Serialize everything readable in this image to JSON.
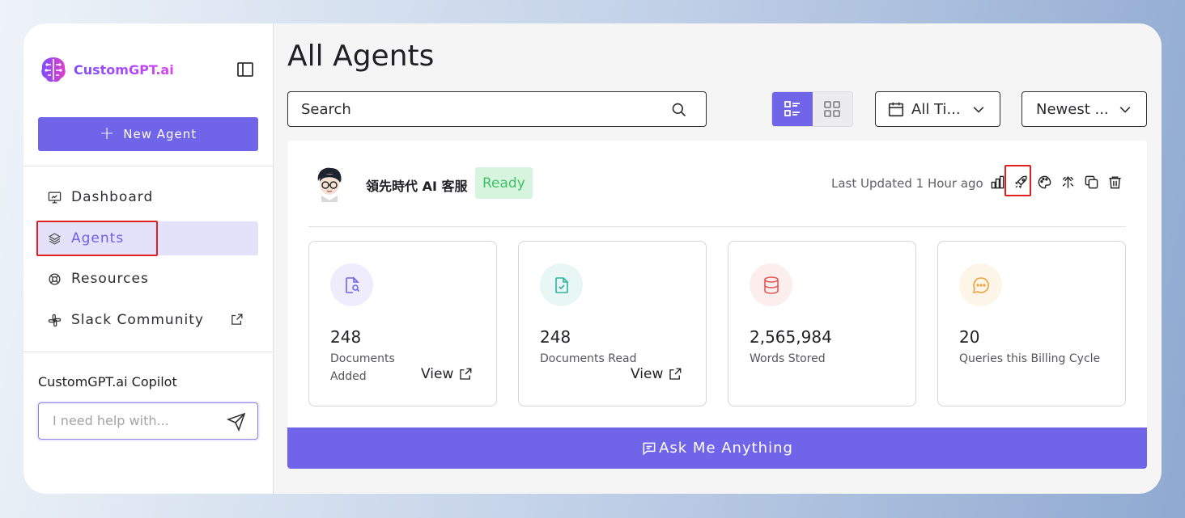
{
  "brand": {
    "name": "CustomGPT.ai",
    "accent": "#7064e9"
  },
  "sidebar": {
    "new_agent_label": "New Agent",
    "items": [
      {
        "label": "Dashboard",
        "icon": "monitor-icon"
      },
      {
        "label": "Agents",
        "icon": "layers-icon",
        "active": true
      },
      {
        "label": "Resources",
        "icon": "lifebuoy-icon"
      },
      {
        "label": "Slack Community",
        "icon": "slack-icon",
        "external": true
      }
    ],
    "copilot": {
      "title": "CustomGPT.ai Copilot",
      "placeholder": "I need help with..."
    }
  },
  "main": {
    "title": "All Agents",
    "search_placeholder": "Search",
    "date_filter": "All Ti...",
    "sort": "Newest ...",
    "agent": {
      "name": "領先時代 AI 客服",
      "status": "Ready",
      "last_updated": "Last Updated 1 Hour ago",
      "actions": [
        "bar-chart-icon",
        "rocket-icon",
        "palette-icon",
        "share-icon",
        "copy-icon",
        "trash-icon"
      ],
      "stats": [
        {
          "value": "248",
          "label": "Documents Added",
          "link": "View",
          "icon": "document-search-icon",
          "color": "#7064e9"
        },
        {
          "value": "248",
          "label": "Documents Read",
          "link": "View",
          "icon": "document-check-icon",
          "color": "#2bb3a0"
        },
        {
          "value": "2,565,984",
          "label": "Words Stored",
          "icon": "database-icon",
          "color": "#e25a5a"
        },
        {
          "value": "20",
          "label": "Queries this Billing Cycle",
          "icon": "chat-icon",
          "color": "#f0a23a"
        }
      ]
    },
    "ask_label": "Ask Me Anything"
  }
}
